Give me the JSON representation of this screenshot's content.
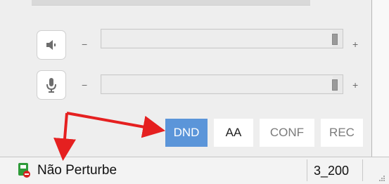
{
  "audio": {
    "speaker": {
      "icon": "speaker-icon",
      "minus_label": "−",
      "plus_label": "+",
      "level": 0.98
    },
    "microphone": {
      "icon": "microphone-icon",
      "minus_label": "−",
      "plus_label": "+",
      "level": 0.98
    }
  },
  "mode_buttons": [
    {
      "label": "DND",
      "active": true
    },
    {
      "label": "AA",
      "active": false
    },
    {
      "label": "CONF",
      "active": false
    },
    {
      "label": "REC",
      "active": false
    }
  ],
  "status_bar": {
    "icon": "phone-status-icon",
    "status_text": "Não Perturbe",
    "extension": "3_200",
    "grip_icon": "resize-grip-icon"
  },
  "annotation": {
    "arrow_color": "#e52020"
  },
  "colors": {
    "accent": "#5b95d9",
    "status_green": "#2f9b3a",
    "status_red": "#d72020"
  }
}
